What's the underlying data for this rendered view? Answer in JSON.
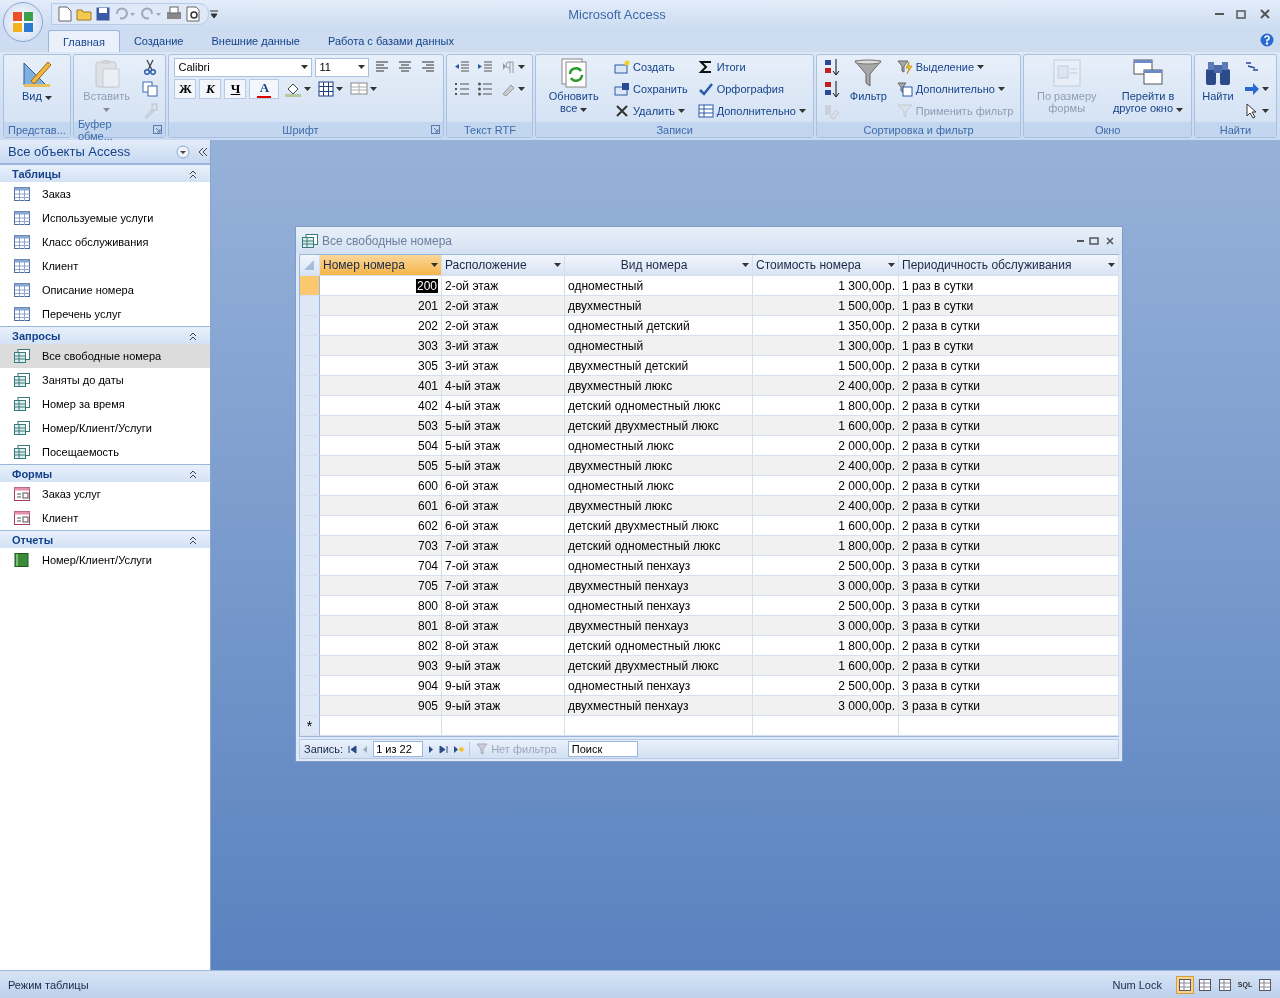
{
  "window": {
    "title": "Microsoft Access"
  },
  "ribbon_tabs": [
    {
      "label": "Главная",
      "selected": true
    },
    {
      "label": "Создание",
      "selected": false
    },
    {
      "label": "Внешние данные",
      "selected": false
    },
    {
      "label": "Работа с базами данных",
      "selected": false
    }
  ],
  "ribbon_groups": [
    {
      "label": "Представ...",
      "items": [
        {
          "kind": "large",
          "label": "Вид",
          "dropdown": true,
          "disabled": false
        }
      ]
    },
    {
      "label": "Буфер обме...",
      "launcher": true,
      "items": [
        {
          "kind": "large",
          "label": "Вставить",
          "dropdown": true,
          "disabled": true
        },
        {
          "kind": "icon",
          "dropdown": false,
          "disabled": false
        },
        {
          "kind": "icon",
          "dropdown": false,
          "disabled": false
        },
        {
          "kind": "icon",
          "dropdown": false,
          "disabled": true
        }
      ]
    },
    {
      "label": "Шрифт",
      "launcher": true,
      "items": [
        {
          "kind": "strip",
          "items": [
            {
              "kind": "field",
              "value": "Calibri",
              "wide": true
            },
            {
              "kind": "field",
              "value": "11",
              "wide": false
            },
            {
              "kind": "icon",
              "dropdown": false
            },
            {
              "kind": "icon",
              "dropdown": false
            },
            {
              "kind": "icon",
              "dropdown": false
            }
          ]
        },
        {
          "kind": "strip",
          "items": [
            {
              "kind": "glyph",
              "label": "Ж"
            },
            {
              "kind": "glyph",
              "label": "К"
            },
            {
              "kind": "glyph",
              "label": "Ч"
            },
            {
              "kind": "color-glyph",
              "label": "A",
              "color": "#e00000"
            },
            {
              "kind": "icon",
              "dropdown": true
            },
            {
              "kind": "icon",
              "dropdown": true
            },
            {
              "kind": "icon",
              "dropdown": true
            }
          ]
        }
      ]
    },
    {
      "label": "Текст RTF",
      "launcher": false,
      "items": [
        {
          "kind": "strip",
          "items": [
            {
              "kind": "icon",
              "dropdown": false
            },
            {
              "kind": "icon",
              "dropdown": false
            },
            {
              "kind": "icon",
              "dropdown": true
            }
          ]
        },
        {
          "kind": "strip",
          "items": [
            {
              "kind": "icon",
              "dropdown": false
            },
            {
              "kind": "icon",
              "dropdown": false
            },
            {
              "kind": "icon",
              "dropdown": true
            }
          ]
        }
      ]
    },
    {
      "label": "Записи",
      "launcher": false,
      "items": [
        {
          "kind": "large",
          "label": "Обновить все",
          "dropdown": true,
          "disabled": false
        },
        {
          "kind": "small",
          "label": "Создать",
          "dropdown": false,
          "disabled": false
        },
        {
          "kind": "small",
          "label": "Сохранить",
          "dropdown": false,
          "disabled": false
        },
        {
          "kind": "small",
          "label": "Удалить",
          "dropdown": true,
          "disabled": false
        },
        {
          "kind": "small",
          "label": "Итоги",
          "dropdown": false,
          "disabled": false
        },
        {
          "kind": "small",
          "label": "Орфография",
          "dropdown": false,
          "disabled": false
        },
        {
          "kind": "small",
          "label": "Дополнительно",
          "dropdown": true,
          "disabled": false
        }
      ]
    },
    {
      "label": "Сортировка и фильтр",
      "launcher": false,
      "items": [
        {
          "kind": "icon",
          "dropdown": false,
          "disabled": false
        },
        {
          "kind": "icon",
          "dropdown": false,
          "disabled": false
        },
        {
          "kind": "icon",
          "dropdown": false,
          "disabled": true
        },
        {
          "kind": "large",
          "label": "Фильтр",
          "dropdown": false,
          "disabled": false
        },
        {
          "kind": "small",
          "label": "Выделение",
          "dropdown": true,
          "disabled": false
        },
        {
          "kind": "small",
          "label": "Дополнительно",
          "dropdown": true,
          "disabled": false
        },
        {
          "kind": "small",
          "label": "Применить фильтр",
          "dropdown": false,
          "disabled": true
        }
      ]
    },
    {
      "label": "Окно",
      "launcher": false,
      "items": [
        {
          "kind": "large",
          "label": "По размеру формы",
          "dropdown": false,
          "disabled": true
        },
        {
          "kind": "large",
          "label": "Перейти в другое окно",
          "dropdown": true,
          "disabled": false
        }
      ]
    },
    {
      "label": "Найти",
      "launcher": false,
      "items": [
        {
          "kind": "large",
          "label": "Найти",
          "dropdown": false,
          "disabled": false
        },
        {
          "kind": "icon",
          "dropdown": false,
          "disabled": false
        },
        {
          "kind": "icon",
          "dropdown": true,
          "disabled": false
        },
        {
          "kind": "icon",
          "dropdown": true,
          "disabled": false
        }
      ]
    }
  ],
  "nav_pane": {
    "title": "Все объекты Access",
    "groups": [
      {
        "label": "Таблицы",
        "kind": "table",
        "items": [
          {
            "label": "Заказ",
            "selected": false
          },
          {
            "label": "Используемые услуги",
            "selected": false
          },
          {
            "label": "Класс обслуживания",
            "selected": false
          },
          {
            "label": "Клиент",
            "selected": false
          },
          {
            "label": "Описание номера",
            "selected": false
          },
          {
            "label": "Перечень услуг",
            "selected": false
          }
        ]
      },
      {
        "label": "Запросы",
        "kind": "query",
        "items": [
          {
            "label": "Все свободные номера",
            "selected": true
          },
          {
            "label": "Заняты до даты",
            "selected": false
          },
          {
            "label": "Номер за время",
            "selected": false
          },
          {
            "label": "Номер/Клиент/Услуги",
            "selected": false
          },
          {
            "label": "Посещаемость",
            "selected": false
          }
        ]
      },
      {
        "label": "Формы",
        "kind": "form",
        "items": [
          {
            "label": "Заказ услуг",
            "selected": false
          },
          {
            "label": "Клиент",
            "selected": false
          }
        ]
      },
      {
        "label": "Отчеты",
        "kind": "report",
        "items": [
          {
            "label": "Номер/Клиент/Услуги",
            "selected": false
          }
        ]
      }
    ]
  },
  "datasheet": {
    "title": "Все свободные номера",
    "columns": [
      {
        "label": "Номер номера",
        "kind": "number",
        "selected": true
      },
      {
        "label": "Расположение",
        "kind": "text",
        "selected": false
      },
      {
        "label": "Вид номера",
        "kind": "text",
        "selected": false
      },
      {
        "label": "Стоимость номера",
        "kind": "number",
        "selected": false
      },
      {
        "label": "Периодичность обслуживания",
        "kind": "text",
        "selected": false
      }
    ],
    "rows": [
      {
        "cells": [
          "200",
          "2-ой этаж",
          "одноместный",
          "1 300,00р.",
          "1 раз в сутки"
        ],
        "selected": true
      },
      {
        "cells": [
          "201",
          "2-ой этаж",
          "двухместный",
          "1 500,00р.",
          "1 раз в сутки"
        ],
        "selected": false
      },
      {
        "cells": [
          "202",
          "2-ой этаж",
          "одноместный детский",
          "1 350,00р.",
          "2 раза в сутки"
        ],
        "selected": false
      },
      {
        "cells": [
          "303",
          "3-ий этаж",
          "одноместный",
          "1 300,00р.",
          "1 раз в сутки"
        ],
        "selected": false
      },
      {
        "cells": [
          "305",
          "3-ий этаж",
          "двухместный детский",
          "1 500,00р.",
          "2 раза в сутки"
        ],
        "selected": false
      },
      {
        "cells": [
          "401",
          "4-ый этаж",
          "двухместный люкс",
          "2 400,00р.",
          "2 раза в сутки"
        ],
        "selected": false
      },
      {
        "cells": [
          "402",
          "4-ый этаж",
          "детский одноместный люкс",
          "1 800,00р.",
          "2 раза в сутки"
        ],
        "selected": false
      },
      {
        "cells": [
          "503",
          "5-ый этаж",
          "детский двухместный люкс",
          "1 600,00р.",
          "2 раза в сутки"
        ],
        "selected": false
      },
      {
        "cells": [
          "504",
          "5-ый этаж",
          "одноместный люкс",
          "2 000,00р.",
          "2 раза в сутки"
        ],
        "selected": false
      },
      {
        "cells": [
          "505",
          "5-ый этаж",
          "двухместный люкс",
          "2 400,00р.",
          "2 раза в сутки"
        ],
        "selected": false
      },
      {
        "cells": [
          "600",
          "6-ой этаж",
          "одноместный люкс",
          "2 000,00р.",
          "2 раза в сутки"
        ],
        "selected": false
      },
      {
        "cells": [
          "601",
          "6-ой этаж",
          "двухместный люкс",
          "2 400,00р.",
          "2 раза в сутки"
        ],
        "selected": false
      },
      {
        "cells": [
          "602",
          "6-ой этаж",
          "детский двухместный люкс",
          "1 600,00р.",
          "2 раза в сутки"
        ],
        "selected": false
      },
      {
        "cells": [
          "703",
          "7-ой этаж",
          "детский одноместный люкс",
          "1 800,00р.",
          "2 раза в сутки"
        ],
        "selected": false
      },
      {
        "cells": [
          "704",
          "7-ой этаж",
          "одноместный пенхауз",
          "2 500,00р.",
          "3 раза в сутки"
        ],
        "selected": false
      },
      {
        "cells": [
          "705",
          "7-ой этаж",
          "двухместный пенхауз",
          "3 000,00р.",
          "3 раза в сутки"
        ],
        "selected": false
      },
      {
        "cells": [
          "800",
          "8-ой этаж",
          "одноместный пенхауз",
          "2 500,00р.",
          "3 раза в сутки"
        ],
        "selected": false
      },
      {
        "cells": [
          "801",
          "8-ой этаж",
          "двухместный пенхауз",
          "3 000,00р.",
          "3 раза в сутки"
        ],
        "selected": false
      },
      {
        "cells": [
          "802",
          "8-ой этаж",
          "детский одноместный люкс",
          "1 800,00р.",
          "2 раза в сутки"
        ],
        "selected": false
      },
      {
        "cells": [
          "903",
          "9-ый этаж",
          "детский двухместный люкс",
          "1 600,00р.",
          "2 раза в сутки"
        ],
        "selected": false
      },
      {
        "cells": [
          "904",
          "9-ый этаж",
          "одноместный пенхауз",
          "2 500,00р.",
          "3 раза в сутки"
        ],
        "selected": false
      },
      {
        "cells": [
          "905",
          "9-ый этаж",
          "двухместный пенхауз",
          "3 000,00р.",
          "3 раза в сутки"
        ],
        "selected": false
      }
    ],
    "new_row_marker": "*",
    "record_nav": {
      "label": "Запись:",
      "position": "1 из 22",
      "filter": "Нет фильтра",
      "search_placeholder": "Поиск"
    }
  },
  "status_bar": {
    "mode": "Режим таблицы",
    "indicator": "Num Lock",
    "views": [
      {
        "selected": true
      },
      {
        "selected": false
      },
      {
        "selected": false
      },
      {
        "label": "SQL",
        "selected": false
      },
      {
        "selected": false
      }
    ]
  }
}
